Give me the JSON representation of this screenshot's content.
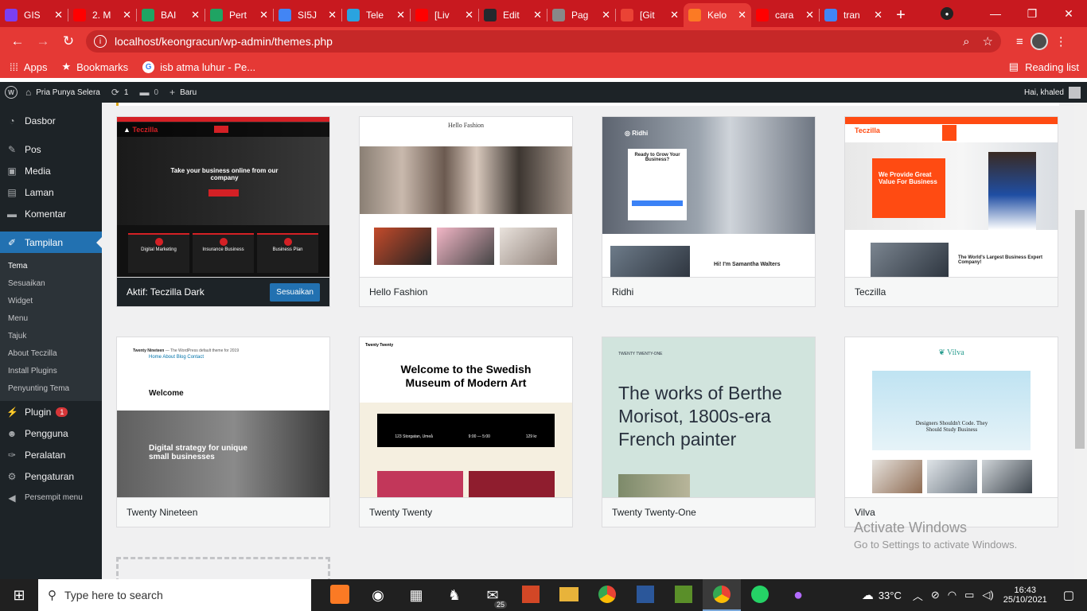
{
  "browser": {
    "tabs": [
      {
        "title": "GIS",
        "color": "#7b3ff2",
        "icon": "contacts-icon"
      },
      {
        "title": "2. M",
        "color": "#ff0000",
        "icon": "youtube-icon"
      },
      {
        "title": "BAI",
        "color": "#1fa463",
        "icon": "drive-icon"
      },
      {
        "title": "Pert",
        "color": "#1fa463",
        "icon": "drive-icon"
      },
      {
        "title": "SI5J",
        "color": "#4285f4",
        "icon": "contacts-icon"
      },
      {
        "title": "Tele",
        "color": "#2aa3df",
        "icon": "telegram-icon"
      },
      {
        "title": "[Liv",
        "color": "#ff0000",
        "icon": "youtube-icon"
      },
      {
        "title": "Edit",
        "color": "#24292e",
        "icon": "github-icon"
      },
      {
        "title": "Pag",
        "color": "#888888",
        "icon": "globe-icon"
      },
      {
        "title": "[Git",
        "color": "#ea4335",
        "icon": "gmail-icon"
      },
      {
        "title": "Kelo",
        "color": "#fb7a24",
        "icon": "xampp-icon",
        "active": true
      },
      {
        "title": "cara",
        "color": "#ff0000",
        "icon": "youtube-icon"
      },
      {
        "title": "tran",
        "color": "#4285f4",
        "icon": "google-icon"
      }
    ],
    "url": "localhost/keongracun/wp-admin/themes.php",
    "bookmarks": {
      "apps": "Apps",
      "bookmarks": "Bookmarks",
      "isb": "isb atma luhur - Pe...",
      "reading_list": "Reading list"
    }
  },
  "wp_admin_bar": {
    "site_name": "Pria Punya Selera",
    "updates_count": "1",
    "comments_count": "0",
    "new_label": "Baru",
    "greeting": "Hai, khaled"
  },
  "admin_menu": {
    "items": [
      {
        "label": "Dasbor",
        "icon": "dashboard-icon"
      },
      {
        "label": "Pos",
        "icon": "pin-icon"
      },
      {
        "label": "Media",
        "icon": "media-icon"
      },
      {
        "label": "Laman",
        "icon": "page-icon"
      },
      {
        "label": "Komentar",
        "icon": "comment-icon"
      },
      {
        "label": "Tampilan",
        "icon": "brush-icon"
      }
    ],
    "submenu": [
      "Tema",
      "Sesuaikan",
      "Widget",
      "Menu",
      "Tajuk",
      "About Teczilla",
      "Install Plugins",
      "Penyunting Tema"
    ],
    "lower_items": [
      {
        "label": "Plugin",
        "icon": "plugin-icon",
        "badge": "1"
      },
      {
        "label": "Pengguna",
        "icon": "user-icon"
      },
      {
        "label": "Peralatan",
        "icon": "wrench-icon"
      },
      {
        "label": "Pengaturan",
        "icon": "settings-icon"
      },
      {
        "label": "Persempit menu",
        "icon": "collapse-icon"
      }
    ]
  },
  "themes": {
    "active_label": "Aktif: Teczilla Dark",
    "customize_label": "Sesuaikan",
    "names": [
      "Hello Fashion",
      "Ridhi",
      "Teczilla",
      "Twenty Nineteen",
      "Twenty Twenty",
      "Twenty Twenty-One",
      "Vilva"
    ]
  },
  "screens": {
    "teczilla_dark_headline": "Take your business online from our company",
    "teczilla_dark_cards": [
      "Digital Marketing",
      "Insurance Business",
      "Business Plan"
    ],
    "hello_fashion_logo": "Hello Fashion",
    "ridhi_logo": "Ridhi",
    "ridhi_headline": "Ready to Grow Your Business?",
    "ridhi_sub": "Hi! I'm Samantha Walters",
    "teczilla_logo": "Teczilla",
    "teczilla_headline": "We Provide Great Value For Business",
    "teczilla_sub": "The World's Largest Business Expert Company!",
    "tn_site": "Twenty Nineteen",
    "tn_tagline": "— The WordPress default theme for 2019",
    "tn_nav": "Home  About  Blog  Contact",
    "tn_welcome": "Welcome",
    "tn_hero": "Digital strategy for unique small businesses",
    "tt_site": "Twenty Twenty",
    "tt_headline": "Welcome to the Swedish Museum of Modern Art",
    "tt_address": "123 Storgatan, Umeå",
    "tt_hours": "9:00 — 5:00",
    "tt_price": "129 kr",
    "t21_site": "TWENTY TWENTY-ONE",
    "t21_headline": "The works of Berthe Morisot, 1800s-era French painter",
    "vilva_logo": "Vilva",
    "vilva_headline": "Designers Shouldn't Code. They Should Study Business"
  },
  "watermark": {
    "title": "Activate Windows",
    "sub": "Go to Settings to activate Windows."
  },
  "taskbar": {
    "search_placeholder": "Type here to search",
    "temperature": "33°C",
    "time": "16:43",
    "date": "25/10/2021",
    "mail_badge": "25"
  }
}
